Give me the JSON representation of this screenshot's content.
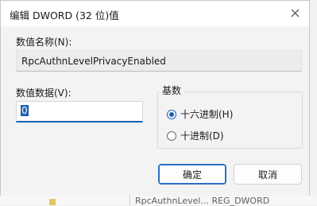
{
  "dialog": {
    "title": "编辑 DWORD (32 位)值",
    "close_glyph": "✕",
    "name_label": "数值名称(N):",
    "name_value": "RpcAuthnLevelPrivacyEnabled",
    "data_label": "数值数据(V):",
    "data_value": "0",
    "base_label": "基数",
    "radio_hex": "十六进制(H)",
    "radio_dec": "十进制(D)",
    "ok_label": "确定",
    "cancel_label": "取消"
  },
  "background": {
    "visible_text": "RpcAuthnLevel... REG_DWORD"
  },
  "colors": {
    "accent": "#1a5fb4"
  }
}
